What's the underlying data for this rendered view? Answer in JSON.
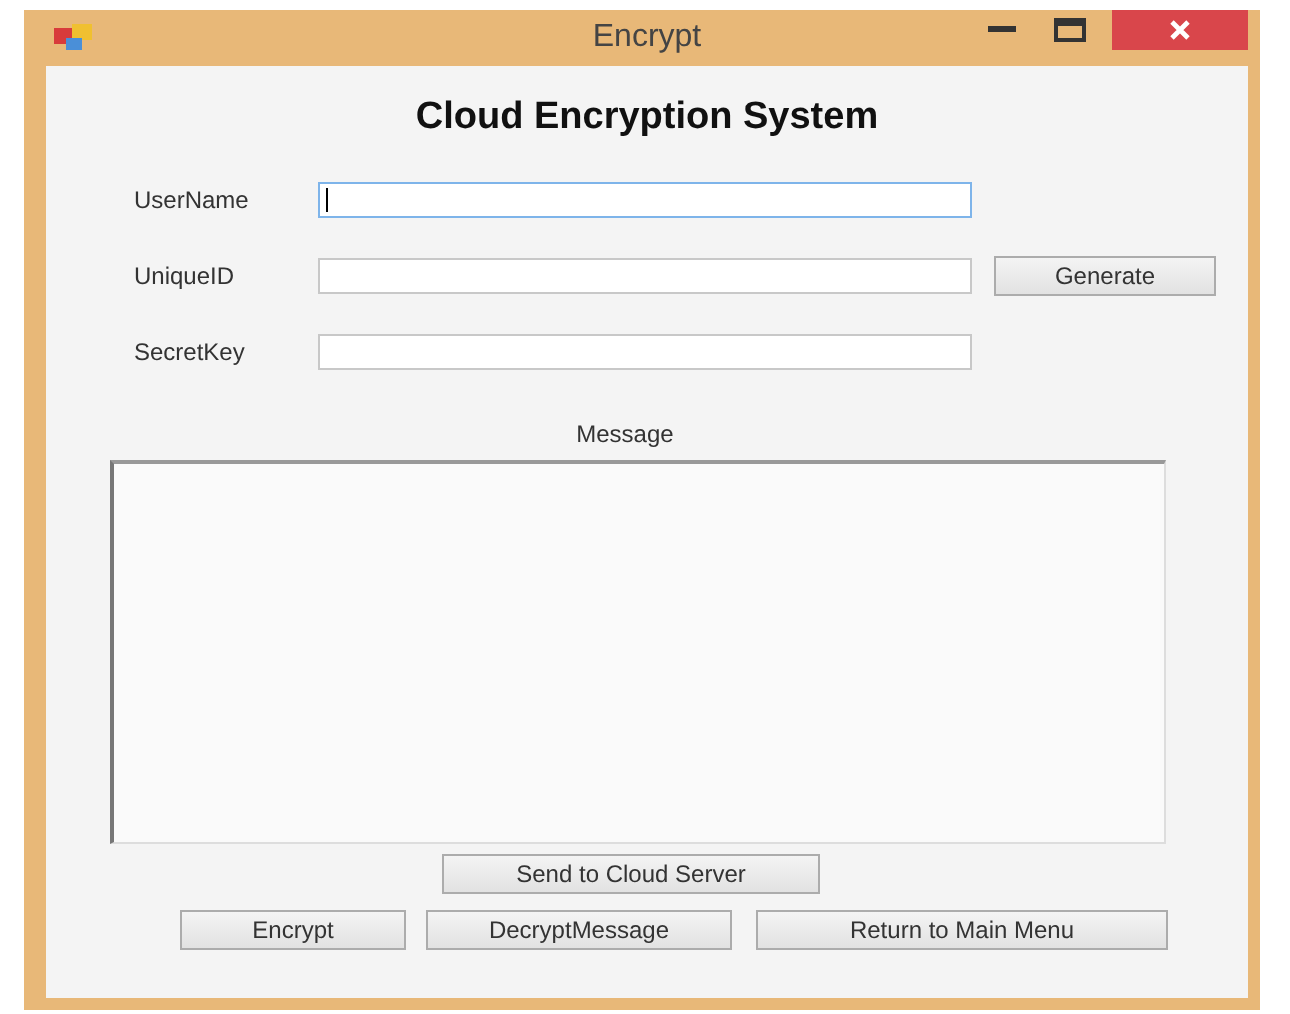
{
  "window": {
    "title": "Encrypt"
  },
  "heading": "Cloud Encryption System",
  "fields": [
    {
      "label": "UserName",
      "focused": true
    },
    {
      "label": "UniqueID",
      "focused": false,
      "button": "Generate"
    },
    {
      "label": "SecretKey",
      "focused": false
    }
  ],
  "message": {
    "label": "Message"
  },
  "send_button": "Send to Cloud Server",
  "buttons": [
    "Encrypt",
    "DecryptMessage",
    "Return to Main Menu"
  ]
}
